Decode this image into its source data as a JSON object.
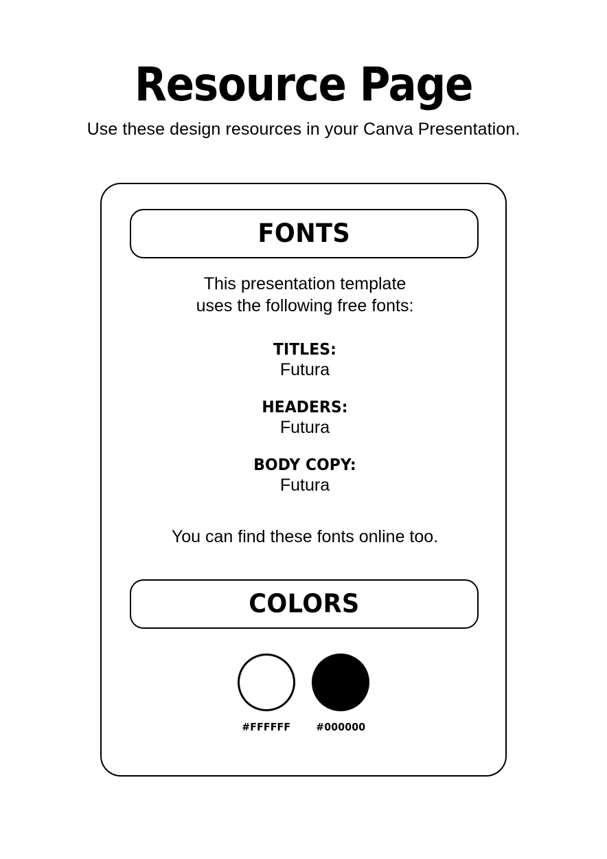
{
  "header": {
    "title": "Resource Page",
    "subtitle": "Use these design resources in your Canva Presentation."
  },
  "card": {
    "fonts_section": {
      "heading": "FONTS",
      "intro_line_1": "This presentation template",
      "intro_line_2": "uses the following free fonts:",
      "entries": [
        {
          "role": "TITLES:",
          "font": "Futura"
        },
        {
          "role": "HEADERS:",
          "font": "Futura"
        },
        {
          "role": "BODY COPY:",
          "font": "Futura"
        }
      ],
      "footnote": "You can find these fonts online too."
    },
    "colors_section": {
      "heading": "COLORS",
      "swatches": [
        {
          "hex": "#FFFFFF",
          "label": "#FFFFFF",
          "style": "light"
        },
        {
          "hex": "#000000",
          "label": "#000000",
          "style": "dark"
        }
      ]
    }
  },
  "theme": {
    "background": "#FFFFFF",
    "foreground": "#000000",
    "outline": "#000000"
  }
}
